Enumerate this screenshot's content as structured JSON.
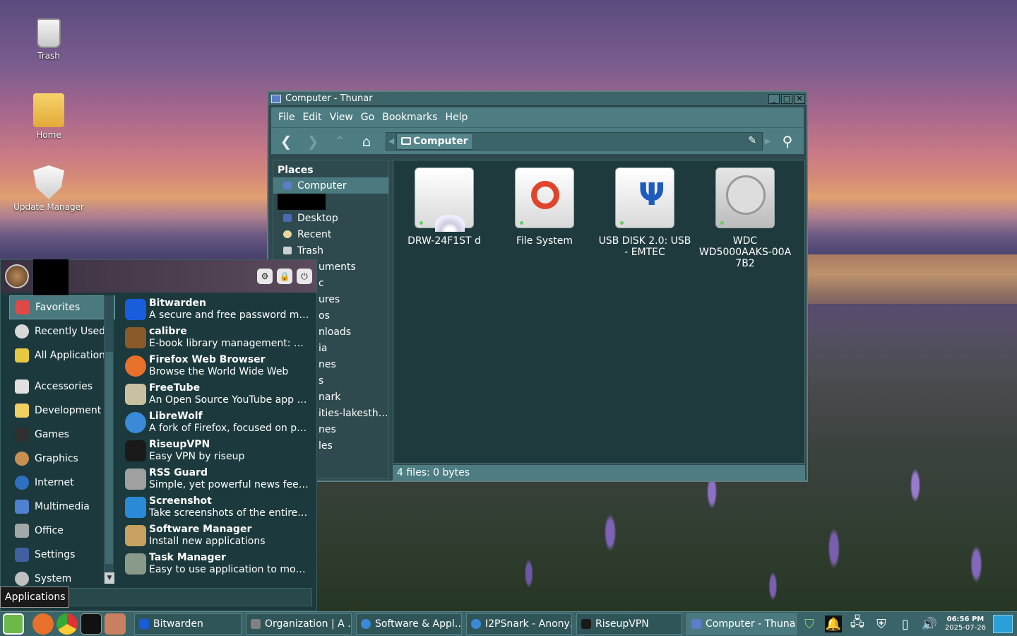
{
  "desktop": {
    "icons": [
      {
        "label": "Trash"
      },
      {
        "label": "Home"
      },
      {
        "label": "Update Manager"
      }
    ]
  },
  "thunar": {
    "title": "Computer - Thunar",
    "menu": [
      "File",
      "Edit",
      "View",
      "Go",
      "Bookmarks",
      "Help"
    ],
    "path_crumb": "Computer",
    "places_heading": "Places",
    "places": [
      {
        "label": "Computer",
        "active": true
      },
      {
        "label": "Desktop"
      },
      {
        "label": "Recent"
      },
      {
        "label": "Trash"
      }
    ],
    "partial_places": [
      "uments",
      "c",
      "ures",
      "os",
      "nloads",
      "ia",
      "nes",
      "s",
      "nark",
      "ities-lakesth…",
      "nes",
      "les"
    ],
    "drives": [
      {
        "label": "DRW-24F1ST   d",
        "type": "optical"
      },
      {
        "label": "File System",
        "type": "filesystem"
      },
      {
        "label": "USB DISK 2.0: USB - EMTEC",
        "type": "usb"
      },
      {
        "label": "WDC WD5000AAKS-00A 7B2",
        "type": "hdd"
      }
    ],
    "status": "4 files: 0 bytes"
  },
  "startmenu": {
    "categories": [
      {
        "label": "Favorites",
        "active": true,
        "color": "#e04848"
      },
      {
        "label": "Recently Used",
        "color": "#d8d8d8"
      },
      {
        "label": "All Applications",
        "color": "#e8c840"
      },
      {
        "label": "Accessories",
        "color": "#e0e0e0"
      },
      {
        "label": "Development",
        "color": "#f0d060"
      },
      {
        "label": "Games",
        "color": "#303030"
      },
      {
        "label": "Graphics",
        "color": "#c89050"
      },
      {
        "label": "Internet",
        "color": "#3070c0"
      },
      {
        "label": "Multimedia",
        "color": "#5080d0"
      },
      {
        "label": "Office",
        "color": "#a0a8a8"
      },
      {
        "label": "Settings",
        "color": "#4060a0"
      },
      {
        "label": "System",
        "color": "#c0c0c0"
      }
    ],
    "apps": [
      {
        "name": "Bitwarden",
        "desc": "A secure and free password ma…",
        "color": "#175ddc"
      },
      {
        "name": "calibre",
        "desc": "E-book library management: Co…",
        "color": "#8a5a2a"
      },
      {
        "name": "Firefox Web Browser",
        "desc": "Browse the World Wide Web",
        "color": "#e8702a"
      },
      {
        "name": "FreeTube",
        "desc": "An Open Source YouTube app f…",
        "color": "#c8c0a0"
      },
      {
        "name": "LibreWolf",
        "desc": "A fork of Firefox, focused on pri…",
        "color": "#3a8ad8"
      },
      {
        "name": "RiseupVPN",
        "desc": "Easy VPN by riseup",
        "color": "#1a1a1a"
      },
      {
        "name": "RSS Guard",
        "desc": "Simple, yet powerful news feed …",
        "color": "#a0a0a0"
      },
      {
        "name": "Screenshot",
        "desc": "Take screenshots of the entire s…",
        "color": "#2a8ad8"
      },
      {
        "name": "Software Manager",
        "desc": "Install new applications",
        "color": "#c8a060"
      },
      {
        "name": "Task Manager",
        "desc": "Easy to use application to monit…",
        "color": "#8a9a8a"
      }
    ],
    "apps_tooltip": "Applications"
  },
  "taskbar": {
    "tasks": [
      {
        "label": "Bitwarden",
        "color": "#175ddc"
      },
      {
        "label": "Organization | A …",
        "color": "#808080"
      },
      {
        "label": "Software & Appl…",
        "color": "#3a8ad8"
      },
      {
        "label": "I2PSnark - Anony…",
        "color": "#3a8ad8"
      },
      {
        "label": "RiseupVPN",
        "color": "#1a1a1a"
      },
      {
        "label": "Computer - Thunar",
        "color": "#5a7ec8",
        "active": true
      }
    ],
    "clock_time": "06:56 PM",
    "clock_date": "2025-07-26"
  }
}
